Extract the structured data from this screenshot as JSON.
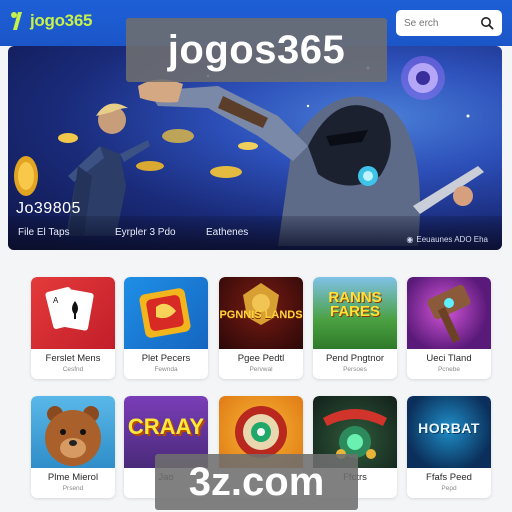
{
  "header": {
    "logo_text": "jogo365",
    "search_placeholder": "Se erch"
  },
  "hero": {
    "title": "Jo39805",
    "links": [
      "File El Taps",
      "Eyrpler 3 Pdo",
      "Eathenes"
    ],
    "right_text": "Eeuaunes ADO Eha"
  },
  "watermarks": {
    "top": "jogos365",
    "bottom": "3z.com"
  },
  "games": [
    {
      "title": "Ferslet Mens",
      "subtitle": "Cesfnd",
      "thumb_text": ""
    },
    {
      "title": "Plet Pecers",
      "subtitle": "Fewnda",
      "thumb_text": ""
    },
    {
      "title": "Pgee Pedtl",
      "subtitle": "Pervwal",
      "thumb_text": "PGNNIS LANDS"
    },
    {
      "title": "Pend Pngtnor",
      "subtitle": "Persoes",
      "thumb_text": "RANNS FARES"
    },
    {
      "title": "Ueci Tland",
      "subtitle": "Pcnebe",
      "thumb_text": ""
    },
    {
      "title": "Plme Mierol",
      "subtitle": "Prsend",
      "thumb_text": ""
    },
    {
      "title": "Jao",
      "subtitle": "",
      "thumb_text": "CRAAY"
    },
    {
      "title": "",
      "subtitle": "",
      "thumb_text": ""
    },
    {
      "title": "Ffctrs",
      "subtitle": "",
      "thumb_text": ""
    },
    {
      "title": "Ffafs Peed",
      "subtitle": "Pepd",
      "thumb_text": "HORBAT"
    }
  ],
  "colors": {
    "header_bg": "#1b56c8",
    "logo_accent": "#c6f14a",
    "page_bg": "#f4f5f7"
  }
}
